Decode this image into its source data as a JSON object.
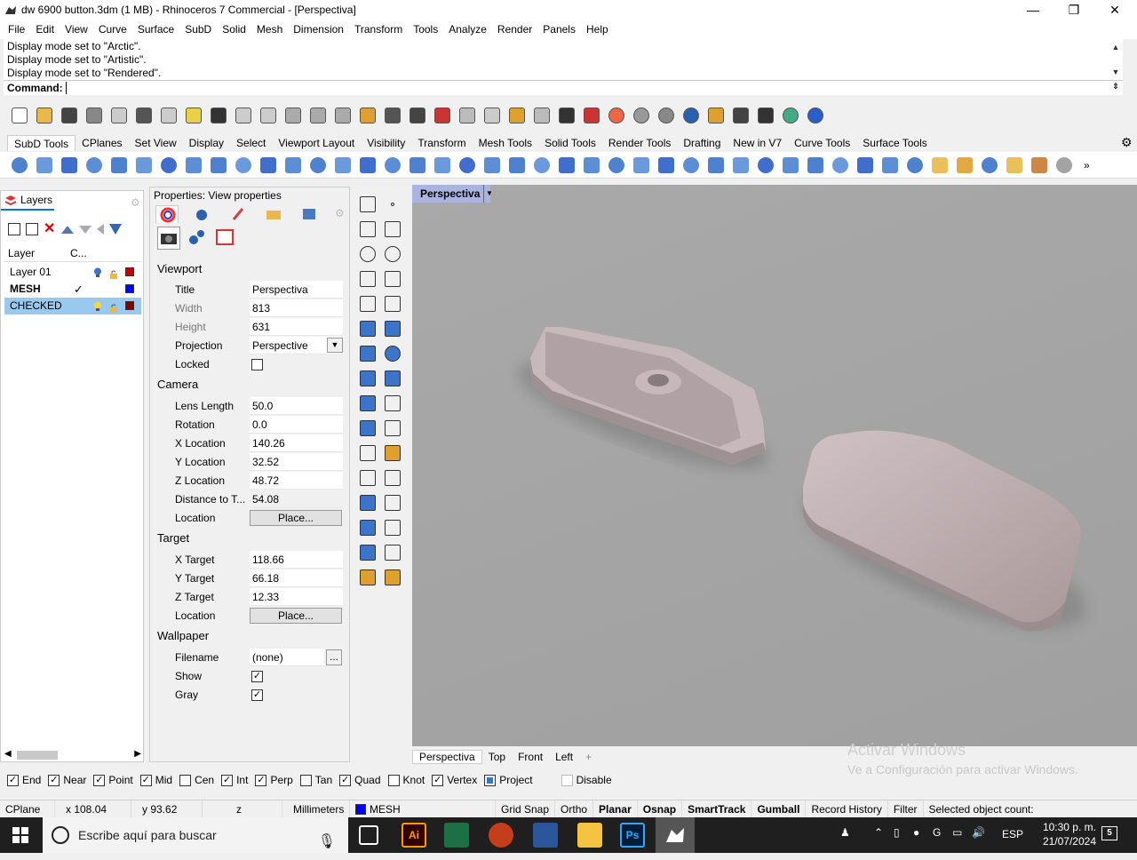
{
  "window": {
    "title": "dw 6900 button.3dm (1 MB) - Rhinoceros 7 Commercial - [Perspectiva]",
    "minimize": "—",
    "maximize": "❐",
    "close": "✕"
  },
  "menu": [
    "File",
    "Edit",
    "View",
    "Curve",
    "Surface",
    "SubD",
    "Solid",
    "Mesh",
    "Dimension",
    "Transform",
    "Tools",
    "Analyze",
    "Render",
    "Panels",
    "Help"
  ],
  "history": [
    "Display mode set to \"Arctic\".",
    "Display mode set to \"Artistic\".",
    "Display mode set to \"Rendered\"."
  ],
  "command": {
    "label": "Command:",
    "value": ""
  },
  "toolbar_tabs": [
    "SubD Tools",
    "CPlanes",
    "Set View",
    "Display",
    "Select",
    "Viewport Layout",
    "Visibility",
    "Transform",
    "Mesh Tools",
    "Solid Tools",
    "Render Tools",
    "Drafting",
    "New in V7",
    "Curve Tools",
    "Surface Tools"
  ],
  "layers": {
    "tab_label": "Layers",
    "columns": [
      "Layer",
      "C..."
    ],
    "rows": [
      {
        "name": "Layer 01",
        "current": false,
        "color": "#c00000",
        "selected": false,
        "bold": false
      },
      {
        "name": "MESH",
        "current": true,
        "color": "#0000ff",
        "selected": false,
        "bold": true
      },
      {
        "name": "CHECKED",
        "current": false,
        "color": "#800000",
        "selected": true,
        "bold": false
      }
    ]
  },
  "properties": {
    "title": "Properties: View properties",
    "viewport": {
      "heading": "Viewport",
      "title_label": "Title",
      "title_value": "Perspectiva",
      "width_label": "Width",
      "width_value": "813",
      "height_label": "Height",
      "height_value": "631",
      "projection_label": "Projection",
      "projection_value": "Perspective",
      "locked_label": "Locked",
      "locked": false
    },
    "camera": {
      "heading": "Camera",
      "lens_label": "Lens Length",
      "lens_value": "50.0",
      "rotation_label": "Rotation",
      "rotation_value": "0.0",
      "x_label": "X Location",
      "x_value": "140.26",
      "y_label": "Y Location",
      "y_value": "32.52",
      "z_label": "Z Location",
      "z_value": "48.72",
      "dist_label": "Distance to T...",
      "dist_value": "54.08",
      "loc_label": "Location",
      "loc_button": "Place..."
    },
    "target": {
      "heading": "Target",
      "x_label": "X Target",
      "x_value": "118.66",
      "y_label": "Y Target",
      "y_value": "66.18",
      "z_label": "Z Target",
      "z_value": "12.33",
      "loc_label": "Location",
      "loc_button": "Place..."
    },
    "wallpaper": {
      "heading": "Wallpaper",
      "file_label": "Filename",
      "file_value": "(none)",
      "file_button": "...",
      "show_label": "Show",
      "show": true,
      "gray_label": "Gray",
      "gray": true
    }
  },
  "viewport": {
    "name": "Perspectiva",
    "tabs": [
      "Perspectiva",
      "Top",
      "Front",
      "Left"
    ],
    "add_tab": "+"
  },
  "watermark": {
    "line1": "Activar Windows",
    "line2": "Ve a Configuración para activar Windows."
  },
  "osnaps": [
    {
      "label": "End",
      "checked": true
    },
    {
      "label": "Near",
      "checked": true
    },
    {
      "label": "Point",
      "checked": true
    },
    {
      "label": "Mid",
      "checked": true
    },
    {
      "label": "Cen",
      "checked": false
    },
    {
      "label": "Int",
      "checked": true
    },
    {
      "label": "Perp",
      "checked": true
    },
    {
      "label": "Tan",
      "checked": false
    },
    {
      "label": "Quad",
      "checked": true
    },
    {
      "label": "Knot",
      "checked": false
    },
    {
      "label": "Vertex",
      "checked": true
    },
    {
      "label": "Project",
      "checked": false
    },
    {
      "label": "Disable",
      "checked": false
    }
  ],
  "status": {
    "cplane": "CPlane",
    "x": "x 108.04",
    "y": "y 93.62",
    "z": "z",
    "units": "Millimeters",
    "layer": "MESH",
    "grid_snap": "Grid Snap",
    "ortho": "Ortho",
    "planar": "Planar",
    "osnap": "Osnap",
    "smarttrack": "SmartTrack",
    "gumball": "Gumball",
    "record": "Record History",
    "filter": "Filter",
    "selected": "Selected object count:"
  },
  "taskbar": {
    "search_placeholder": "Escribe aquí para buscar",
    "lang": "ESP",
    "time": "10:30 p. m.",
    "date": "21/07/2024",
    "notifications": "5"
  }
}
